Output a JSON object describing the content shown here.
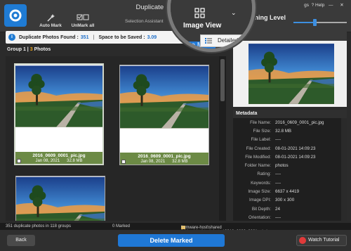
{
  "window": {
    "title": "Duplicate Photos Fixer Pro",
    "settings_label": "gs",
    "help_label": "? Help",
    "minimize": "—",
    "close": "✕"
  },
  "toolbar": {
    "auto_mark": "Auto Mark",
    "unmark_all": "UnMark all",
    "selection_assistant": "Selection Assistant",
    "image_view": "Image View",
    "matching_level": "Matching Level",
    "matching_level_value": 0.4
  },
  "view_menu": {
    "detailed_view": "Detailed View"
  },
  "infobar": {
    "found_label": "Duplicate Photos Found :",
    "found_value": "351",
    "saved_label": "Space to be Saved :",
    "saved_value": "3.09",
    "delete_marked_fragment": "Delete Mark"
  },
  "group": {
    "label": "Group 1 |",
    "count": "3",
    "photos": "Photos"
  },
  "thumbnails": [
    {
      "filename": "2016_0609_0001_pic.jpg",
      "date": "Jan 08, 2021",
      "size": "32.8 MB",
      "selected": true
    },
    {
      "filename": "2016_0609_0001_pic.jpg",
      "date": "Jan 08, 2021",
      "size": "32.8 MB",
      "selected": false
    },
    {
      "filename": "2016_0609_0001_pic.jpg",
      "date": "Jan 08, 2021",
      "size": "32.8 MB",
      "selected": false
    }
  ],
  "metadata": {
    "header": "Metadata",
    "rows": [
      {
        "k": "File Name:",
        "v": "2016_0609_0001_pic.jpg"
      },
      {
        "k": "File Size:",
        "v": "32.8 MB"
      },
      {
        "k": "File Label:",
        "v": "----"
      },
      {
        "k": "File Created:",
        "v": "08-01-2021 14:09:23"
      },
      {
        "k": "File Modified:",
        "v": "08-01-2021 14:09:23"
      },
      {
        "k": "Folder Name:",
        "v": "photos"
      },
      {
        "k": "Rating:",
        "v": "----"
      },
      {
        "k": "Keywords:",
        "v": "----"
      },
      {
        "k": "Image Size:",
        "v": "6637 x 4419"
      },
      {
        "k": "Image DPI:",
        "v": "300 x 300"
      },
      {
        "k": "Bit Depth:",
        "v": "24"
      },
      {
        "k": "Orientation:",
        "v": "----"
      }
    ]
  },
  "status": {
    "summary": "351 duplicate photos in 118 groups",
    "marked": "0 Marked",
    "path": "\\\\vmware-host\\shared folders\\desktop\\photos\\2016_0609_0001_pic.jpg"
  },
  "bottom": {
    "back": "Back",
    "delete_marked": "Delete Marked",
    "watch_tutorial": "Watch Tutorial"
  },
  "colors": {
    "accent": "#1f78d6",
    "caption_green": "#6c8a45",
    "group_count": "#e8a21a"
  }
}
